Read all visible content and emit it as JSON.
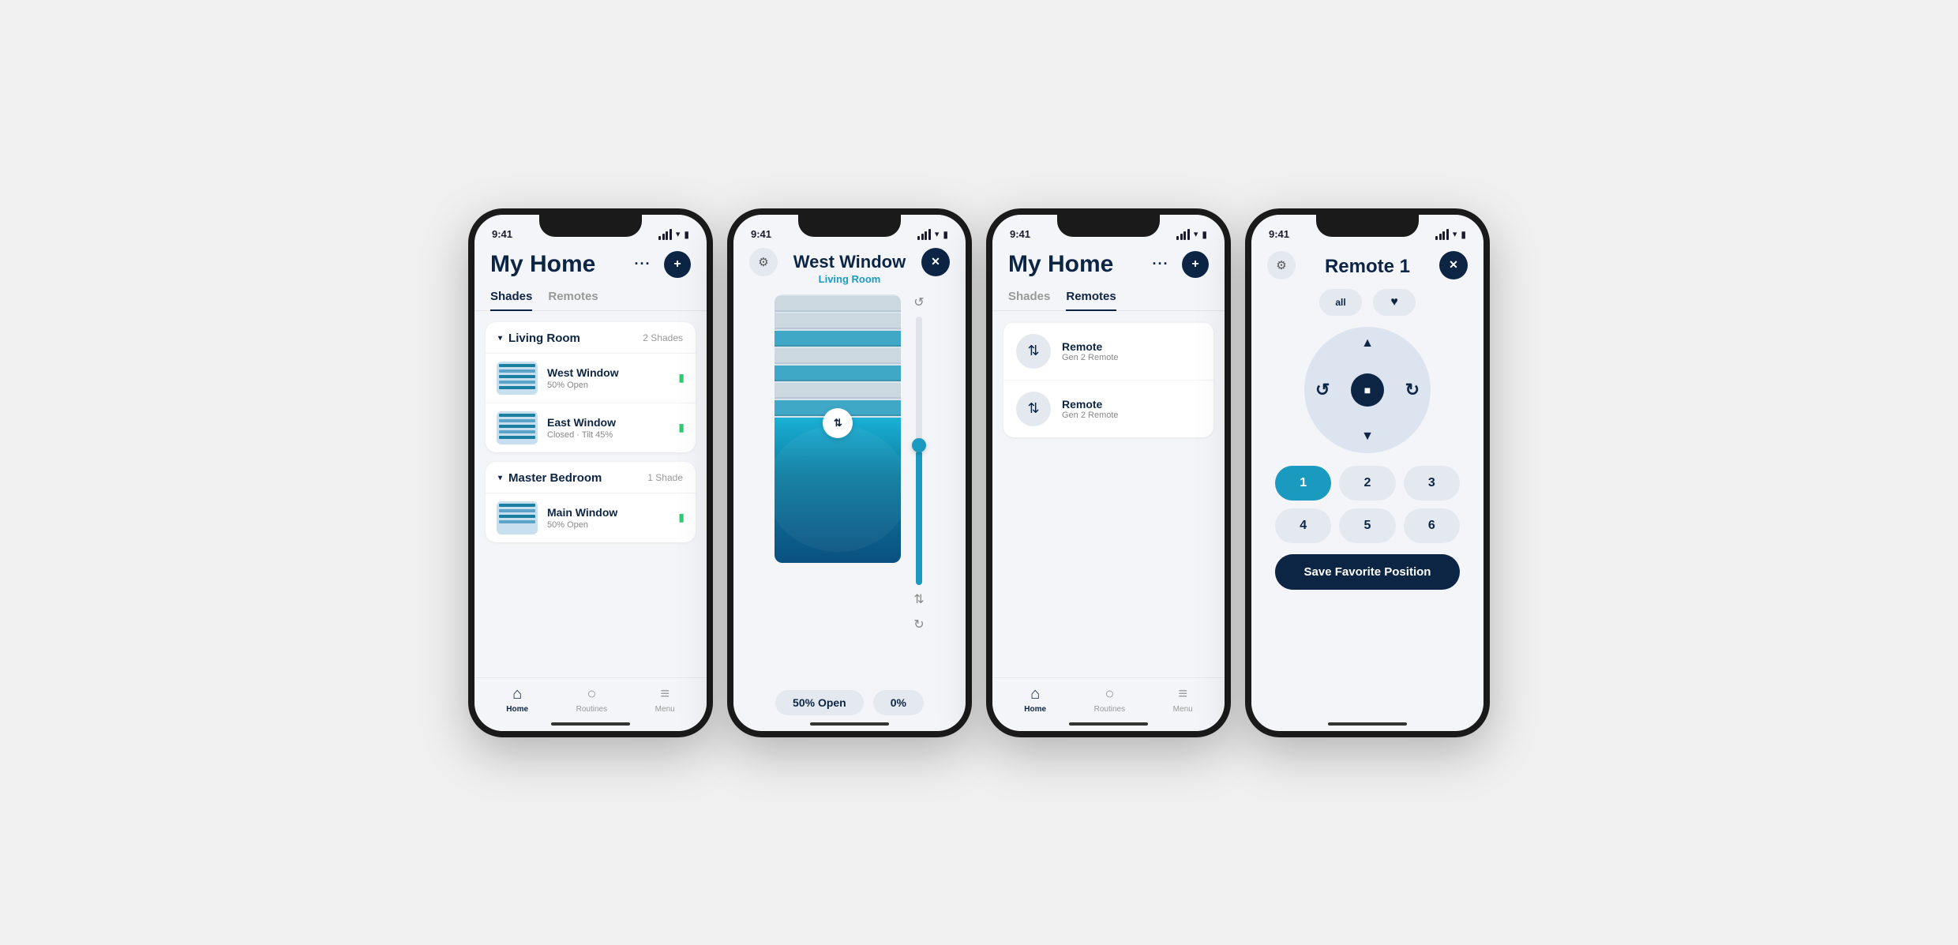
{
  "phones": {
    "phone1": {
      "status_time": "9:41",
      "title": "My Home",
      "tabs": [
        "Shades",
        "Remotes"
      ],
      "active_tab": "Shades",
      "rooms": [
        {
          "name": "Living Room",
          "count": "2 Shades",
          "shades": [
            {
              "name": "West Window",
              "status": "50% Open",
              "battery": "🔋"
            },
            {
              "name": "East Window",
              "status": "Closed · Tilt 45%",
              "battery": "🔋"
            }
          ]
        },
        {
          "name": "Master Bedroom",
          "count": "1 Shade",
          "shades": [
            {
              "name": "Main Window",
              "status": "50% Open",
              "battery": "🔋"
            }
          ]
        }
      ],
      "nav": [
        {
          "label": "Home",
          "active": true
        },
        {
          "label": "Routines",
          "active": false
        },
        {
          "label": "Menu",
          "active": false
        }
      ]
    },
    "phone2": {
      "status_time": "9:41",
      "shade_title": "West Window",
      "shade_subtitle": "Living Room",
      "open_label": "50% Open",
      "tilt_label": "0%"
    },
    "phone3": {
      "status_time": "9:41",
      "title": "My Home",
      "tabs": [
        "Shades",
        "Remotes"
      ],
      "active_tab": "Remotes",
      "remotes": [
        {
          "name": "Remote",
          "type": "Gen 2 Remote"
        },
        {
          "name": "Remote",
          "type": "Gen 2 Remote"
        }
      ],
      "nav": [
        {
          "label": "Home",
          "active": true
        },
        {
          "label": "Routines",
          "active": false
        },
        {
          "label": "Menu",
          "active": false
        }
      ]
    },
    "phone4": {
      "status_time": "9:41",
      "remote_title": "Remote 1",
      "all_label": "all",
      "fav_icon": "♥",
      "dpad_up": "▲",
      "dpad_down": "▼",
      "dpad_left_icon": "↺",
      "dpad_right_icon": "↻",
      "dpad_stop_icon": "■",
      "number_buttons": [
        "1",
        "2",
        "3",
        "4",
        "5",
        "6"
      ],
      "active_number": "1",
      "save_label": "Save Favorite Position"
    }
  }
}
